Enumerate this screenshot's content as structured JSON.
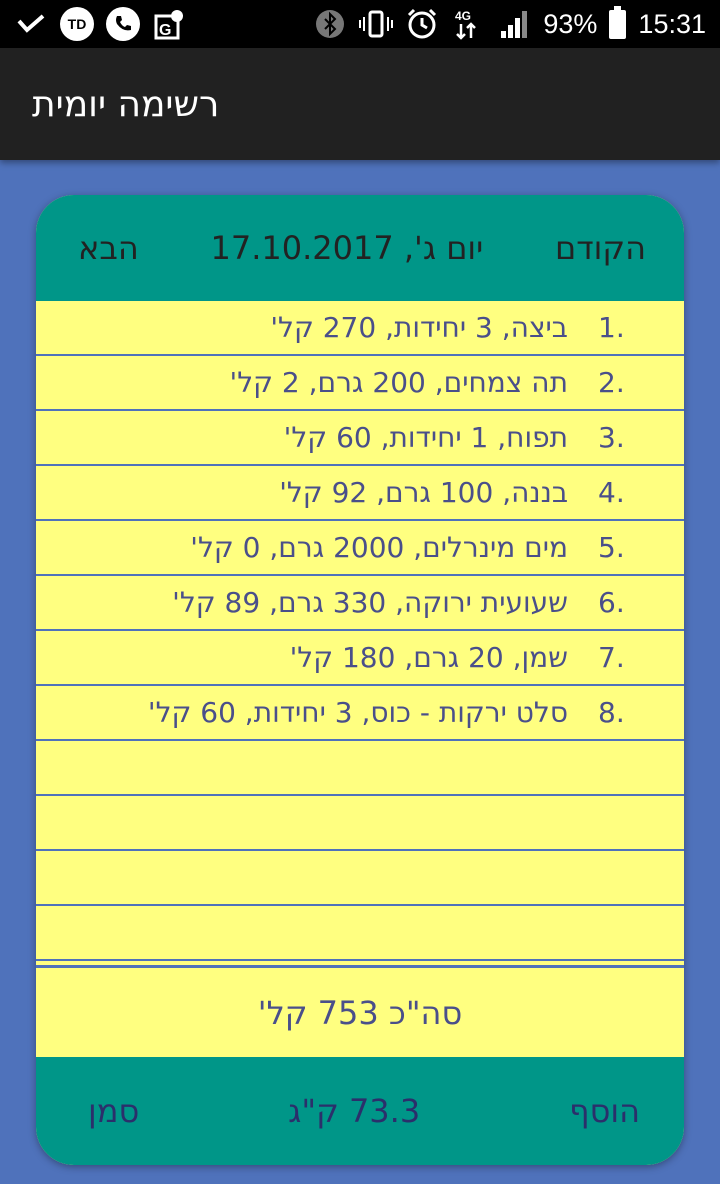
{
  "status_bar": {
    "battery": "93%",
    "time": "15:31",
    "network": "4G",
    "icons_left": [
      "check-icon",
      "td-app-icon",
      "phone-icon",
      "g-maps-icon"
    ],
    "icons_right": [
      "bluetooth-icon",
      "vibrate-icon",
      "alarm-icon",
      "signal-icon",
      "battery-icon"
    ]
  },
  "appbar": {
    "title": "רשימה יומית"
  },
  "header": {
    "prev_label": "הקודם",
    "date": "יום ג', 17.10.2017",
    "next_label": "הבא"
  },
  "items": [
    {
      "num": "1.",
      "text": "ביצה,  3 יחידות, 270 קל'"
    },
    {
      "num": "2.",
      "text": "תה צמחים,  200 גרם, 2 קל'"
    },
    {
      "num": "3.",
      "text": "תפוח,  1 יחידות, 60 קל'"
    },
    {
      "num": "4.",
      "text": "בננה,  100 גרם, 92 קל'"
    },
    {
      "num": "5.",
      "text": "מים מינרלים,  2000 גרם, 0 קל'"
    },
    {
      "num": "6.",
      "text": "שעועית ירוקה,  330 גרם, 89 קל'"
    },
    {
      "num": "7.",
      "text": "שמן,  20 גרם, 180 קל'"
    },
    {
      "num": "8.",
      "text": "סלט ירקות - כוס,  3 יחידות, 60 קל'"
    },
    {
      "num": "",
      "text": ""
    },
    {
      "num": "",
      "text": ""
    },
    {
      "num": "",
      "text": ""
    },
    {
      "num": "",
      "text": ""
    }
  ],
  "total": {
    "label": "סה\"כ 753 קל'"
  },
  "footer": {
    "add_label": "הוסף",
    "weight": "73.3 ק\"ג",
    "mark_label": "סמן"
  },
  "colors": {
    "background": "#4f72bb",
    "teal": "#009688",
    "yellow": "#ffff80",
    "appbar": "#212121"
  }
}
